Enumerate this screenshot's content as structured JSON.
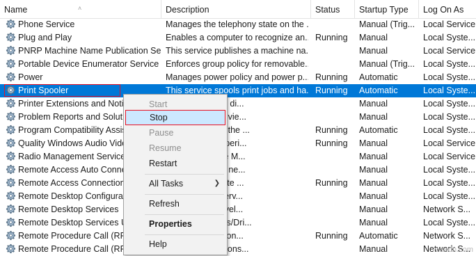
{
  "columns": {
    "name": "Name",
    "description": "Description",
    "status": "Status",
    "startup_type": "Startup Type",
    "log_on_as": "Log On As"
  },
  "rows": [
    {
      "name": "Phone Service",
      "description": "Manages the telephony state on the ...",
      "status": "",
      "startup": "Manual (Trig...",
      "logon": "Local Service"
    },
    {
      "name": "Plug and Play",
      "description": "Enables a computer to recognize an...",
      "status": "Running",
      "startup": "Manual",
      "logon": "Local Syste..."
    },
    {
      "name": "PNRP Machine Name Publication Se...",
      "description": "This service publishes a machine na...",
      "status": "",
      "startup": "Manual",
      "logon": "Local Service"
    },
    {
      "name": "Portable Device Enumerator Service",
      "description": "Enforces group policy for removable...",
      "status": "",
      "startup": "Manual (Trig...",
      "logon": "Local Syste..."
    },
    {
      "name": "Power",
      "description": "Manages power policy and power p...",
      "status": "Running",
      "startup": "Automatic",
      "logon": "Local Syste..."
    },
    {
      "name": "Print Spooler",
      "description": "This service spools print jobs and ha...",
      "status": "Running",
      "startup": "Automatic",
      "logon": "Local Syste..."
    },
    {
      "name": "Printer Extensions and Notific...",
      "description": "s custom printer di...",
      "status": "",
      "startup": "Manual",
      "logon": "Local Syste..."
    },
    {
      "name": "Problem Reports and Solutio...",
      "description": "ides support for vie...",
      "status": "",
      "startup": "Manual",
      "logon": "Local Syste..."
    },
    {
      "name": "Program Compatibility Assist...",
      "description": "ides support for the ...",
      "status": "Running",
      "startup": "Automatic",
      "logon": "Local Syste..."
    },
    {
      "name": "Quality Windows Audio Vide...",
      "description": "Audio Video Experi...",
      "status": "Running",
      "startup": "Manual",
      "logon": "Local Service"
    },
    {
      "name": "Radio Management Service",
      "description": "ent and Airplane M...",
      "status": "",
      "startup": "Manual",
      "logon": "Local Service"
    },
    {
      "name": "Remote Access Auto Connec...",
      "description": "tion to a remote ne...",
      "status": "",
      "startup": "Manual",
      "logon": "Local Syste..."
    },
    {
      "name": "Remote Access Connection M...",
      "description": "and virtual private ...",
      "status": "Running",
      "startup": "Manual",
      "logon": "Local Syste..."
    },
    {
      "name": "Remote Desktop Configuratio...",
      "description": "Configuration serv...",
      "status": "",
      "startup": "Manual",
      "logon": "Local Syste..."
    },
    {
      "name": "Remote Desktop Services",
      "description": "onnect interactivel...",
      "status": "",
      "startup": "Manual",
      "logon": "Network S..."
    },
    {
      "name": "Remote Desktop Services Use...",
      "description": "ection of Printers/Dri...",
      "status": "",
      "startup": "Manual",
      "logon": "Local Syste..."
    },
    {
      "name": "Remote Procedure Call (RPC)",
      "description": "is the Service Con...",
      "status": "Running",
      "startup": "Automatic",
      "logon": "Network S..."
    },
    {
      "name": "Remote Procedure Call (RPC)...",
      "description": "and earlier versions...",
      "status": "",
      "startup": "Manual",
      "logon": "Network S..."
    }
  ],
  "selected_row": "Print Spooler",
  "context_menu": {
    "start": "Start",
    "stop": "Stop",
    "pause": "Pause",
    "resume": "Resume",
    "restart": "Restart",
    "all_tasks": "All Tasks",
    "refresh": "Refresh",
    "properties": "Properties",
    "help": "Help"
  },
  "watermark": "wsxdn.com",
  "colors": {
    "selection": "#0078d7",
    "highlight_border": "#e81123",
    "menu_hover": "#cce8ff"
  },
  "icons": {
    "service": "gear-icon",
    "submenu": "chevron-right-icon",
    "sort": "sort-up-icon"
  }
}
